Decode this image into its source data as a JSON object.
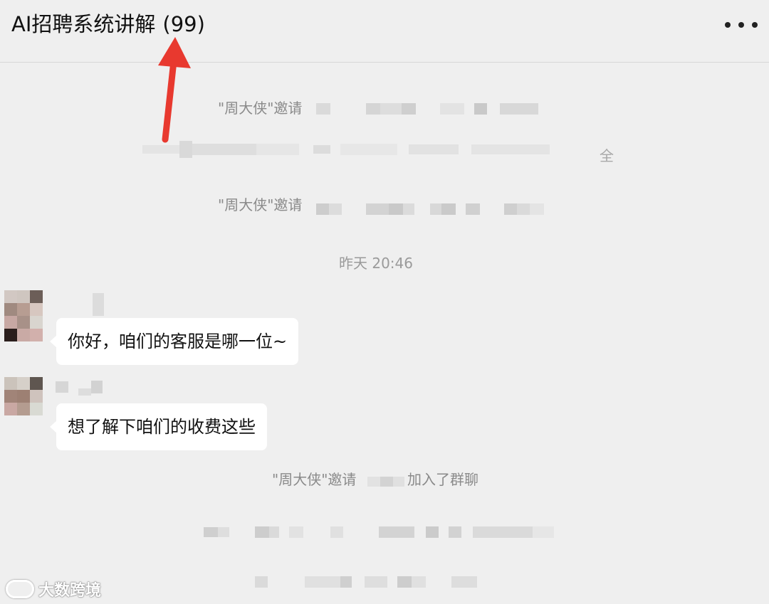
{
  "header": {
    "title": "AI招聘系统讲解",
    "count": "(99)",
    "more_icon": "more-dots-icon"
  },
  "messages": {
    "system_invite_1": "\"周大侠\"邀请",
    "partial_notice_tail": "全",
    "system_invite_2": "\"周大侠\"邀请",
    "timestamp": "昨天 20:46",
    "bubble_1": "你好，咱们的客服是哪一位~",
    "bubble_2": "想了解下咱们的收费这些",
    "system_invite_3_prefix": "\"周大侠\"邀请",
    "system_invite_3_suffix": "加入了群聊"
  },
  "annotation": {
    "arrow_color": "#e8392f"
  },
  "watermark": {
    "text": "大数跨境"
  },
  "colors": {
    "background": "#efefef",
    "bubble": "#ffffff",
    "system_text": "#8a8a8a"
  }
}
